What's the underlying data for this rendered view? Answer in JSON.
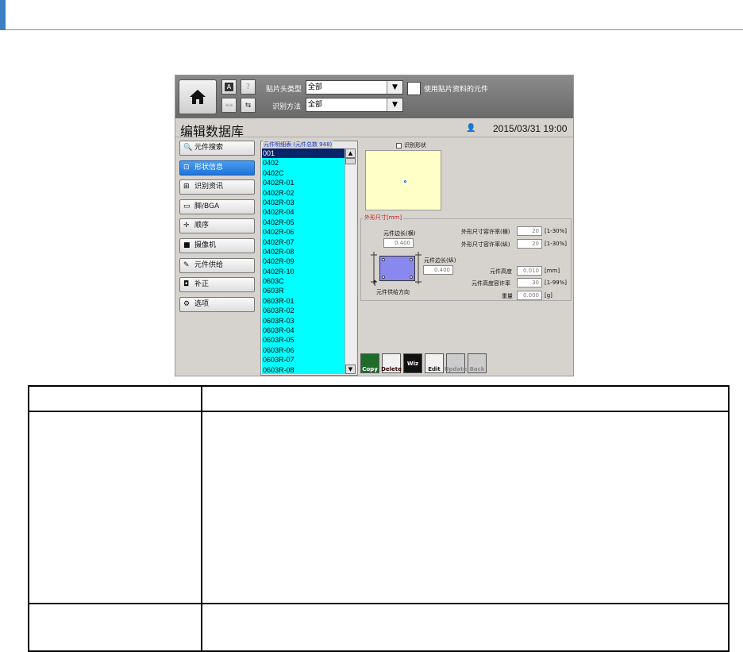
{
  "app": {
    "head_type_label": "贴片头类型",
    "head_type_value": "全部",
    "recog_method_label": "识别方法",
    "recog_method_value": "全部",
    "use_data_label": "使用贴片资料的元件",
    "page_title": "编辑数据库",
    "datetime": "2015/03/31 19:00"
  },
  "nav": [
    {
      "label": "元件搜索",
      "icon": "part-search-icon",
      "selected": false
    },
    {
      "label": "形状信息",
      "icon": "shape-info-icon",
      "selected": true
    },
    {
      "label": "识别资讯",
      "icon": "recognition-icon",
      "selected": false
    },
    {
      "label": "脚/BGA",
      "icon": "lead-bga-icon",
      "selected": false
    },
    {
      "label": "顺序",
      "icon": "sequence-icon",
      "selected": false
    },
    {
      "label": "摄像机",
      "icon": "camera-icon",
      "selected": false
    },
    {
      "label": "元件供给",
      "icon": "feeder-icon",
      "selected": false
    },
    {
      "label": "补正",
      "icon": "correction-icon",
      "selected": false
    },
    {
      "label": "选项",
      "icon": "options-icon",
      "selected": false
    }
  ],
  "parts_list": {
    "header": "元件明细表 (元件总数 948)",
    "items": [
      "001",
      "0402",
      "0402C",
      "0402R-01",
      "0402R-02",
      "0402R-03",
      "0402R-04",
      "0402R-05",
      "0402R-06",
      "0402R-07",
      "0402R-08",
      "0402R-09",
      "0402R-10",
      "0603C",
      "0603R",
      "0603R-01",
      "0603R-02",
      "0603R-03",
      "0603R-04",
      "0603R-05",
      "0603R-06",
      "0603R-07",
      "0603R-08"
    ],
    "selected_index": 0
  },
  "shape": {
    "recog_shape_label": "识别形状",
    "group_title": "外形尺寸[mm]",
    "width_label": "元件边长(横)",
    "width_value": "0.400",
    "length_label": "元件边长(纵)",
    "length_value": "0.400",
    "feed_dir_label": "元件供给方向",
    "tol_x_label": "外形尺寸容许率(横)",
    "tol_x_value": "20",
    "tol_x_range": "[1-30%]",
    "tol_y_label": "外形尺寸容许率(纵)",
    "tol_y_value": "20",
    "tol_y_range": "[1-30%]",
    "height_label": "元件高度",
    "height_value": "0.010",
    "height_unit": "[mm]",
    "height_tol_label": "元件高度容许率",
    "height_tol_value": "30",
    "height_tol_range": "[1-99%]",
    "weight_label": "重量",
    "weight_value": "0.000",
    "weight_unit": "[g]"
  },
  "toolbar": {
    "copy": "Copy",
    "delete": "Delete",
    "wiz": "Wiz",
    "edit": "Edit",
    "update": "Update",
    "back": "Back"
  }
}
